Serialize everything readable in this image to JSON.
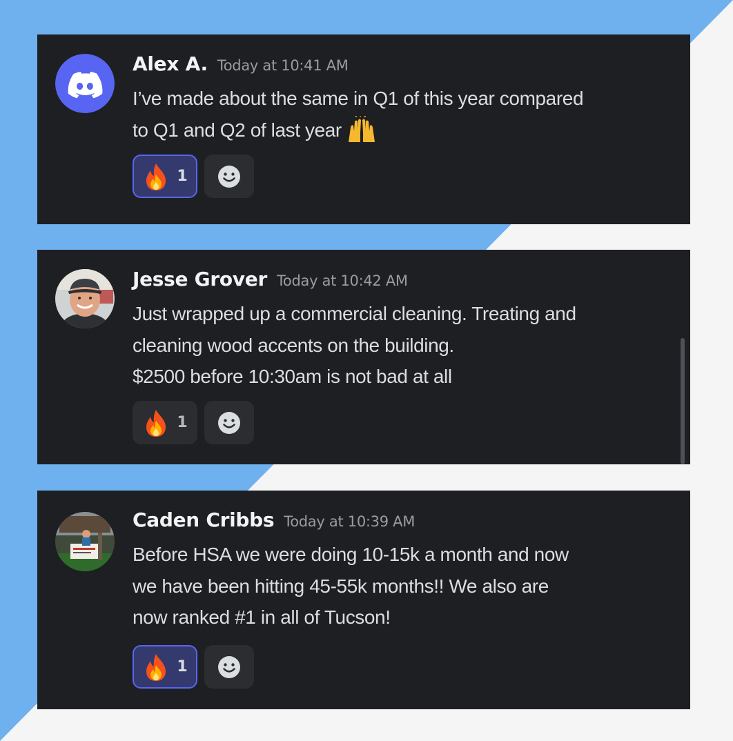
{
  "messages": [
    {
      "username": "Alex A.",
      "timestamp": "Today at 10:41 AM",
      "lines": [
        "I’ve made about the same in Q1 of this year compared",
        "to Q1 and Q2 of last year"
      ],
      "inline_emoji": "raising-hands",
      "avatar": "discord-logo",
      "reaction": {
        "emoji": "fire",
        "count": "1",
        "active": true
      }
    },
    {
      "username": "Jesse Grover",
      "timestamp": "Today at 10:42 AM",
      "lines": [
        "Just wrapped up a commercial cleaning. Treating and",
        "cleaning wood accents on the building.",
        "$2500 before 10:30am is not bad at all"
      ],
      "avatar": "user-photo",
      "reaction": {
        "emoji": "fire",
        "count": "1",
        "active": false
      }
    },
    {
      "username": "Caden Cribbs",
      "timestamp": "Today at 10:39 AM",
      "lines": [
        "Before HSA we were doing 10-15k a month and now",
        "we have been hitting 45-55k months!! We also are",
        "now ranked #1 in all of Tucson!"
      ],
      "avatar": "user-photo",
      "reaction": {
        "emoji": "fire",
        "count": "1",
        "active": true
      }
    }
  ],
  "colors": {
    "card_bg": "#1e1f22",
    "accent_blue": "#6fb1ee",
    "discord_blurple": "#5865f2",
    "reaction_active_bg": "#353a6e"
  }
}
